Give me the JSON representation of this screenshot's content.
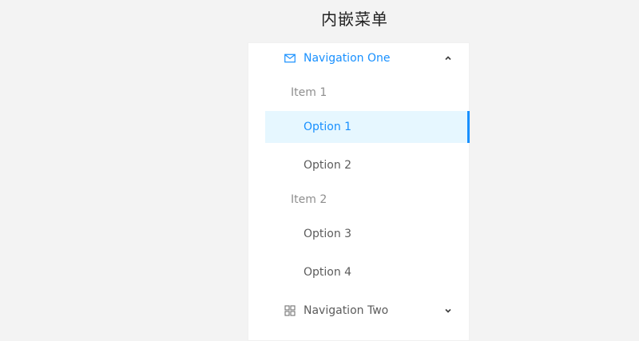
{
  "page": {
    "title": "内嵌菜单"
  },
  "menu": {
    "submenus": [
      {
        "label": "Navigation One",
        "icon": "mail-icon",
        "expanded": true,
        "groups": [
          {
            "title": "Item 1",
            "items": [
              {
                "label": "Option 1",
                "selected": true
              },
              {
                "label": "Option 2",
                "selected": false
              }
            ]
          },
          {
            "title": "Item 2",
            "items": [
              {
                "label": "Option 3",
                "selected": false
              },
              {
                "label": "Option 4",
                "selected": false
              }
            ]
          }
        ]
      },
      {
        "label": "Navigation Two",
        "icon": "appstore-icon",
        "expanded": false
      }
    ]
  },
  "colors": {
    "accent": "#1890ff",
    "selected_bg": "#e6f7ff",
    "page_bg": "#f3f3f3",
    "menu_bg": "#ffffff"
  }
}
